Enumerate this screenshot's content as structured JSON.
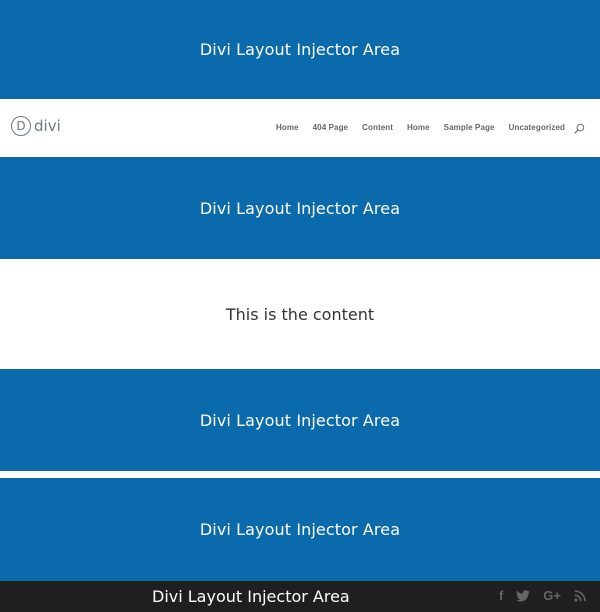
{
  "injector_areas": {
    "top": "Divi Layout Injector Area",
    "below_header": "Divi Layout Injector Area",
    "after_content": "Divi Layout Injector Area",
    "before_footer": "Divi Layout Injector Area",
    "footer": "Divi Layout Injector Area"
  },
  "header": {
    "logo_mark": "D",
    "logo_text": "divi",
    "nav": [
      {
        "label": "Home"
      },
      {
        "label": "404 Page"
      },
      {
        "label": "Content"
      },
      {
        "label": "Home"
      },
      {
        "label": "Sample Page"
      },
      {
        "label": "Uncategorized"
      }
    ],
    "search_icon": "search-icon"
  },
  "content": {
    "text": "This is the content"
  },
  "footer": {
    "social": [
      {
        "icon": "facebook-icon",
        "glyph": "f"
      },
      {
        "icon": "twitter-icon",
        "glyph": ""
      },
      {
        "icon": "google-plus-icon",
        "glyph": "G+"
      },
      {
        "icon": "rss-icon",
        "glyph": ""
      }
    ]
  },
  "colors": {
    "injector_blue": "#0b6aab",
    "footer_bg": "#1f1f1f",
    "nav_text": "#666666",
    "content_text": "#333333"
  }
}
